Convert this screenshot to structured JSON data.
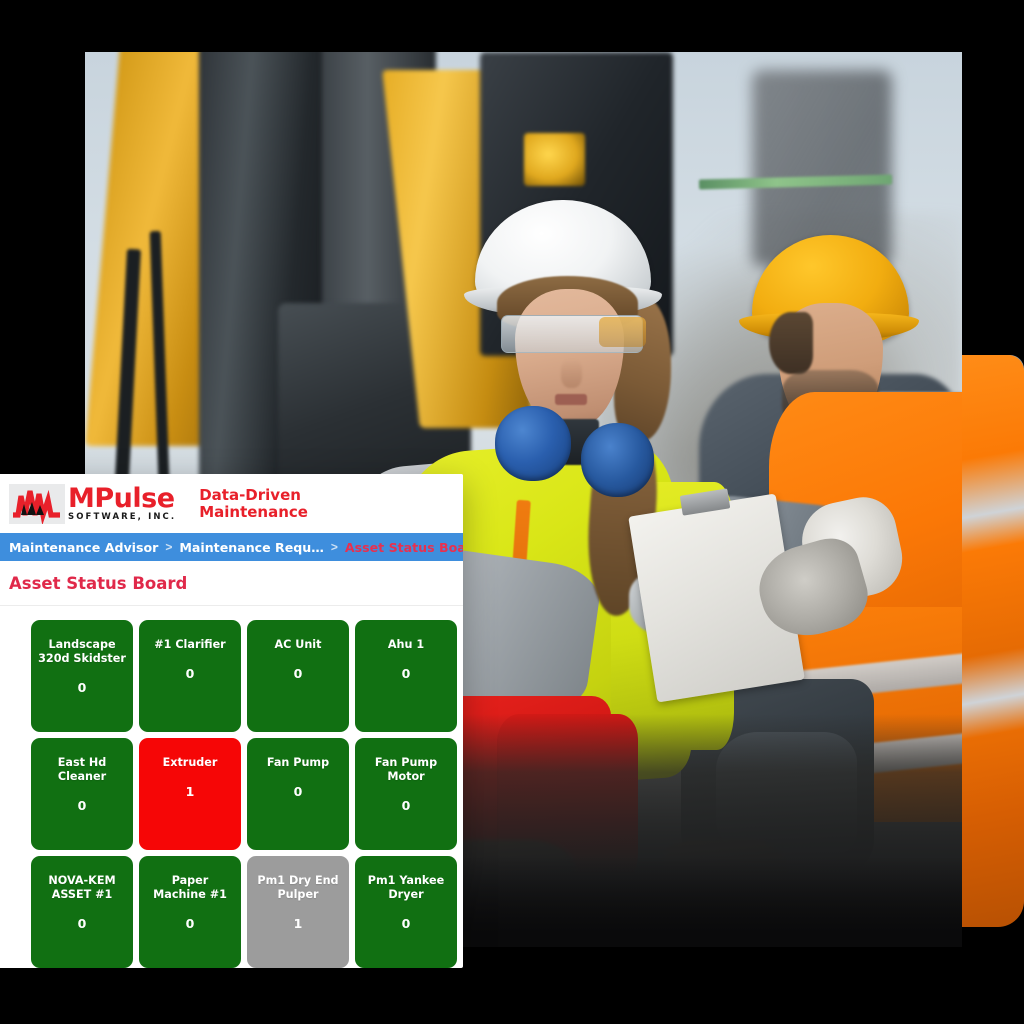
{
  "app": {
    "logo": {
      "mark_icon": "mpulse-pulse-m-icon",
      "name": "MPulse",
      "subtitle": "SOFTWARE, INC.",
      "tagline_line1": "Data-Driven",
      "tagline_line2": "Maintenance",
      "brand_red": "#e8202a"
    }
  },
  "breadcrumb": {
    "separator": ">",
    "items": [
      {
        "label": "Maintenance Advisor",
        "active": false
      },
      {
        "label": "Maintenance Requ…",
        "active": false
      },
      {
        "label": "Asset Status Board",
        "active": true
      }
    ]
  },
  "page": {
    "title": "Asset Status Board",
    "title_color": "#e0294a"
  },
  "status_colors": {
    "ok": "#117012",
    "alert": "#f60606",
    "inactive": "#9c9c9c"
  },
  "asset_tiles": [
    {
      "label": "Landscape 320d Skidster",
      "count": "0",
      "status": "green"
    },
    {
      "label": "#1 Clarifier",
      "count": "0",
      "status": "green"
    },
    {
      "label": "AC Unit",
      "count": "0",
      "status": "green"
    },
    {
      "label": "Ahu 1",
      "count": "0",
      "status": "green"
    },
    {
      "label": "East Hd Cleaner",
      "count": "0",
      "status": "green"
    },
    {
      "label": "Extruder",
      "count": "1",
      "status": "red"
    },
    {
      "label": "Fan Pump",
      "count": "0",
      "status": "green"
    },
    {
      "label": "Fan Pump Motor",
      "count": "0",
      "status": "green"
    },
    {
      "label": "NOVA-KEM ASSET #1",
      "count": "0",
      "status": "green"
    },
    {
      "label": "Paper Machine #1",
      "count": "0",
      "status": "green"
    },
    {
      "label": "Pm1 Dry End Pulper",
      "count": "1",
      "status": "grey"
    },
    {
      "label": "Pm1 Yankee Dryer",
      "count": "0",
      "status": "green"
    }
  ],
  "photo": {
    "alt": "Two industrial maintenance workers in high-visibility vests and hard hats reviewing a clipboard beside a yellow excavator"
  }
}
